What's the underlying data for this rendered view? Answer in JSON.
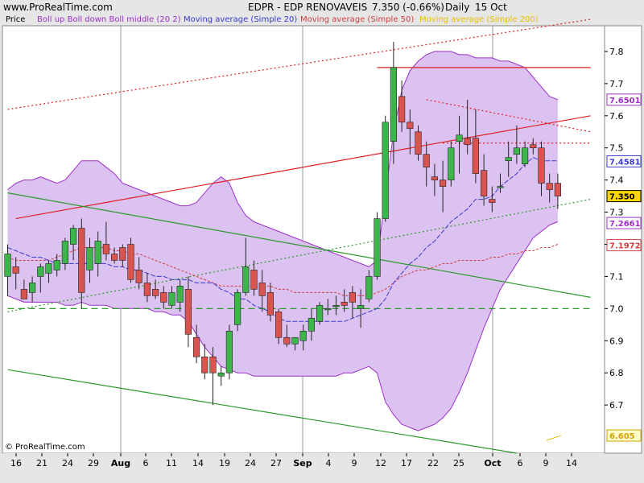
{
  "header": {
    "site": "www.ProRealTime.com",
    "title": "EDPR - EDP RENOVAVEIS",
    "quote": "7.350 (-0.66%)",
    "period": "Daily",
    "date": "15 Oct"
  },
  "legend": {
    "price": "Price",
    "bollinger": "Boll up Boll down Boll middle (20 2)",
    "ma20": "Moving average (Simple 20)",
    "ma50": "Moving average (Simple 50)",
    "ma200": "Moving average (Simple 200)"
  },
  "footer": {
    "copyright": "© ProRealTime.com"
  },
  "colors": {
    "up": "#3cb54a",
    "down": "#d9534f",
    "band_fill": "#dcc2f0",
    "band_line": "#9b30c8",
    "ma20": "#3a3acc",
    "ma50": "#d04040",
    "ma200": "#e8c000",
    "resistance": "#e02020",
    "trend_green": "#2a9a2a"
  },
  "chart_data": {
    "type": "candlestick",
    "ylim": [
      6.55,
      7.88
    ],
    "y_ticks": [
      6.7,
      6.8,
      6.9,
      7.0,
      7.1,
      7.2,
      7.3,
      7.4,
      7.5,
      7.6,
      7.7,
      7.8
    ],
    "x_labels": [
      "16",
      "21",
      "24",
      "29",
      "Aug",
      "6",
      "11",
      "14",
      "19",
      "24",
      "27",
      "Sep",
      "4",
      "9",
      "12",
      "17",
      "22",
      "25",
      "Oct",
      "6",
      "9",
      "14"
    ],
    "price_badges": [
      {
        "value": 7.6501,
        "text": "7.6501",
        "color": "#9b30c8"
      },
      {
        "value": 7.4581,
        "text": "7.4581",
        "color": "#3a3acc"
      },
      {
        "value": 7.35,
        "text": "7.350",
        "color": "#000000",
        "bg": "#ffd700"
      },
      {
        "value": 7.2661,
        "text": "7.2661",
        "color": "#9b30c8"
      },
      {
        "value": 7.1972,
        "text": "7.1972",
        "color": "#d04040"
      },
      {
        "value": 6.605,
        "text": "6.605",
        "color": "#d4a000",
        "bg": "#ffffcc"
      }
    ],
    "candles": [
      {
        "o": 7.1,
        "h": 7.2,
        "l": 7.04,
        "c": 7.17
      },
      {
        "o": 7.13,
        "h": 7.16,
        "l": 7.06,
        "c": 7.11
      },
      {
        "o": 7.06,
        "h": 7.09,
        "l": 7.03,
        "c": 7.03
      },
      {
        "o": 7.05,
        "h": 7.1,
        "l": 7.02,
        "c": 7.08
      },
      {
        "o": 7.1,
        "h": 7.14,
        "l": 7.05,
        "c": 7.13
      },
      {
        "o": 7.11,
        "h": 7.15,
        "l": 7.08,
        "c": 7.14
      },
      {
        "o": 7.12,
        "h": 7.17,
        "l": 7.1,
        "c": 7.15
      },
      {
        "o": 7.14,
        "h": 7.22,
        "l": 7.12,
        "c": 7.21
      },
      {
        "o": 7.2,
        "h": 7.26,
        "l": 7.15,
        "c": 7.25
      },
      {
        "o": 7.25,
        "h": 7.28,
        "l": 7.0,
        "c": 7.05
      },
      {
        "o": 7.12,
        "h": 7.22,
        "l": 7.08,
        "c": 7.19
      },
      {
        "o": 7.14,
        "h": 7.24,
        "l": 7.1,
        "c": 7.21
      },
      {
        "o": 7.2,
        "h": 7.27,
        "l": 7.15,
        "c": 7.17
      },
      {
        "o": 7.17,
        "h": 7.19,
        "l": 7.14,
        "c": 7.15
      },
      {
        "o": 7.19,
        "h": 7.2,
        "l": 7.13,
        "c": 7.15
      },
      {
        "o": 7.2,
        "h": 7.22,
        "l": 7.08,
        "c": 7.09
      },
      {
        "o": 7.12,
        "h": 7.16,
        "l": 7.06,
        "c": 7.08
      },
      {
        "o": 7.08,
        "h": 7.11,
        "l": 7.02,
        "c": 7.04
      },
      {
        "o": 7.06,
        "h": 7.09,
        "l": 7.03,
        "c": 7.04
      },
      {
        "o": 7.05,
        "h": 7.07,
        "l": 7.0,
        "c": 7.02
      },
      {
        "o": 7.01,
        "h": 7.07,
        "l": 7.0,
        "c": 7.05
      },
      {
        "o": 7.02,
        "h": 7.09,
        "l": 6.99,
        "c": 7.07
      },
      {
        "o": 7.06,
        "h": 7.1,
        "l": 6.88,
        "c": 6.92
      },
      {
        "o": 6.91,
        "h": 6.95,
        "l": 6.83,
        "c": 6.85
      },
      {
        "o": 6.85,
        "h": 6.89,
        "l": 6.78,
        "c": 6.8
      },
      {
        "o": 6.85,
        "h": 6.88,
        "l": 6.7,
        "c": 6.8
      },
      {
        "o": 6.79,
        "h": 6.82,
        "l": 6.76,
        "c": 6.8
      },
      {
        "o": 6.8,
        "h": 6.95,
        "l": 6.78,
        "c": 6.93
      },
      {
        "o": 6.95,
        "h": 7.06,
        "l": 6.93,
        "c": 7.05
      },
      {
        "o": 7.05,
        "h": 7.22,
        "l": 7.04,
        "c": 7.13
      },
      {
        "o": 7.12,
        "h": 7.15,
        "l": 7.04,
        "c": 7.06
      },
      {
        "o": 7.08,
        "h": 7.12,
        "l": 6.99,
        "c": 7.04
      },
      {
        "o": 7.05,
        "h": 7.08,
        "l": 6.96,
        "c": 6.98
      },
      {
        "o": 6.99,
        "h": 7.0,
        "l": 6.89,
        "c": 6.91
      },
      {
        "o": 6.91,
        "h": 6.95,
        "l": 6.88,
        "c": 6.89
      },
      {
        "o": 6.89,
        "h": 6.91,
        "l": 6.87,
        "c": 6.91
      },
      {
        "o": 6.9,
        "h": 6.95,
        "l": 6.87,
        "c": 6.93
      },
      {
        "o": 6.93,
        "h": 7.0,
        "l": 6.9,
        "c": 6.97
      },
      {
        "o": 6.96,
        "h": 7.02,
        "l": 6.95,
        "c": 7.01
      },
      {
        "o": 7.0,
        "h": 7.03,
        "l": 6.98,
        "c": 7.0
      },
      {
        "o": 7.01,
        "h": 7.04,
        "l": 6.98,
        "c": 7.01
      },
      {
        "o": 7.02,
        "h": 7.06,
        "l": 6.99,
        "c": 7.01
      },
      {
        "o": 7.05,
        "h": 7.07,
        "l": 6.97,
        "c": 7.02
      },
      {
        "o": 7.0,
        "h": 7.06,
        "l": 6.94,
        "c": 7.01
      },
      {
        "o": 7.03,
        "h": 7.12,
        "l": 7.02,
        "c": 7.1
      },
      {
        "o": 7.1,
        "h": 7.3,
        "l": 7.09,
        "c": 7.28
      },
      {
        "o": 7.28,
        "h": 7.6,
        "l": 7.27,
        "c": 7.58
      },
      {
        "o": 7.52,
        "h": 7.83,
        "l": 7.45,
        "c": 7.75
      },
      {
        "o": 7.66,
        "h": 7.71,
        "l": 7.55,
        "c": 7.58
      },
      {
        "o": 7.58,
        "h": 7.62,
        "l": 7.48,
        "c": 7.56
      },
      {
        "o": 7.55,
        "h": 7.57,
        "l": 7.46,
        "c": 7.48
      },
      {
        "o": 7.48,
        "h": 7.52,
        "l": 7.38,
        "c": 7.44
      },
      {
        "o": 7.41,
        "h": 7.45,
        "l": 7.35,
        "c": 7.4
      },
      {
        "o": 7.4,
        "h": 7.46,
        "l": 7.3,
        "c": 7.38
      },
      {
        "o": 7.4,
        "h": 7.52,
        "l": 7.38,
        "c": 7.5
      },
      {
        "o": 7.52,
        "h": 7.6,
        "l": 7.42,
        "c": 7.54
      },
      {
        "o": 7.53,
        "h": 7.65,
        "l": 7.48,
        "c": 7.51
      },
      {
        "o": 7.53,
        "h": 7.62,
        "l": 7.39,
        "c": 7.42
      },
      {
        "o": 7.43,
        "h": 7.48,
        "l": 7.32,
        "c": 7.35
      },
      {
        "o": 7.34,
        "h": 7.38,
        "l": 7.3,
        "c": 7.33
      },
      {
        "o": 7.38,
        "h": 7.42,
        "l": 7.36,
        "c": 7.38
      },
      {
        "o": 7.46,
        "h": 7.52,
        "l": 7.41,
        "c": 7.47
      },
      {
        "o": 7.48,
        "h": 7.57,
        "l": 7.45,
        "c": 7.5
      },
      {
        "o": 7.45,
        "h": 7.52,
        "l": 7.44,
        "c": 7.5
      },
      {
        "o": 7.51,
        "h": 7.53,
        "l": 7.48,
        "c": 7.5
      },
      {
        "o": 7.5,
        "h": 7.52,
        "l": 7.35,
        "c": 7.39
      },
      {
        "o": 7.39,
        "h": 7.42,
        "l": 7.33,
        "c": 7.37
      },
      {
        "o": 7.39,
        "h": 7.42,
        "l": 7.31,
        "c": 7.35
      }
    ],
    "boll_upper": [
      7.37,
      7.39,
      7.4,
      7.4,
      7.41,
      7.4,
      7.39,
      7.4,
      7.43,
      7.46,
      7.46,
      7.46,
      7.44,
      7.42,
      7.39,
      7.38,
      7.37,
      7.36,
      7.35,
      7.34,
      7.33,
      7.32,
      7.32,
      7.33,
      7.36,
      7.39,
      7.41,
      7.39,
      7.33,
      7.29,
      7.27,
      7.26,
      7.25,
      7.24,
      7.23,
      7.22,
      7.21,
      7.2,
      7.19,
      7.18,
      7.17,
      7.16,
      7.15,
      7.14,
      7.13,
      7.15,
      7.35,
      7.55,
      7.68,
      7.74,
      7.77,
      7.79,
      7.8,
      7.8,
      7.8,
      7.79,
      7.79,
      7.78,
      7.78,
      7.78,
      7.77,
      7.77,
      7.76,
      7.75,
      7.72,
      7.69,
      7.66,
      7.65
    ],
    "boll_lower": [
      7.04,
      7.03,
      7.02,
      7.02,
      7.02,
      7.02,
      7.02,
      7.01,
      7.01,
      7.02,
      7.01,
      7.01,
      7.01,
      7.0,
      7.0,
      7.0,
      7.0,
      7.0,
      6.99,
      6.99,
      6.98,
      6.98,
      6.96,
      6.92,
      6.88,
      6.85,
      6.82,
      6.81,
      6.8,
      6.8,
      6.79,
      6.79,
      6.79,
      6.79,
      6.79,
      6.79,
      6.79,
      6.79,
      6.79,
      6.79,
      6.79,
      6.8,
      6.8,
      6.81,
      6.82,
      6.8,
      6.71,
      6.67,
      6.64,
      6.63,
      6.62,
      6.63,
      6.64,
      6.66,
      6.69,
      6.74,
      6.8,
      6.87,
      6.94,
      7.0,
      7.06,
      7.1,
      7.14,
      7.18,
      7.22,
      7.24,
      7.26,
      7.27
    ],
    "ma20": [
      7.19,
      7.18,
      7.17,
      7.16,
      7.16,
      7.15,
      7.14,
      7.14,
      7.14,
      7.14,
      7.14,
      7.14,
      7.14,
      7.13,
      7.13,
      7.12,
      7.12,
      7.11,
      7.1,
      7.1,
      7.09,
      7.09,
      7.09,
      7.08,
      7.08,
      7.08,
      7.06,
      7.05,
      7.03,
      7.03,
      7.01,
      7.0,
      6.99,
      6.97,
      6.96,
      6.96,
      6.96,
      6.96,
      6.96,
      6.96,
      6.96,
      6.96,
      6.97,
      6.98,
      6.99,
      7.0,
      7.03,
      7.08,
      7.11,
      7.14,
      7.16,
      7.19,
      7.21,
      7.24,
      7.27,
      7.29,
      7.31,
      7.34,
      7.34,
      7.35,
      7.38,
      7.4,
      7.42,
      7.45,
      7.47,
      7.46,
      7.46,
      7.46
    ],
    "ma50": [
      7.16,
      7.15,
      7.15,
      7.15,
      7.15,
      7.15,
      7.16,
      7.17,
      7.18,
      7.19,
      7.19,
      7.19,
      7.19,
      7.18,
      7.18,
      7.17,
      7.17,
      7.16,
      7.15,
      7.14,
      7.13,
      7.12,
      7.11,
      7.1,
      7.09,
      7.08,
      7.07,
      7.07,
      7.07,
      7.07,
      7.07,
      7.07,
      7.07,
      7.06,
      7.06,
      7.05,
      7.05,
      7.05,
      7.05,
      7.05,
      7.05,
      7.04,
      7.04,
      7.04,
      7.04,
      7.05,
      7.06,
      7.08,
      7.1,
      7.11,
      7.12,
      7.12,
      7.13,
      7.14,
      7.14,
      7.15,
      7.15,
      7.15,
      7.15,
      7.16,
      7.16,
      7.17,
      7.17,
      7.18,
      7.18,
      7.19,
      7.19,
      7.2
    ],
    "ma200": [
      6.605,
      6.605,
      6.605,
      6.605,
      6.605,
      6.605,
      6.605,
      6.605,
      6.605,
      6.605,
      6.605,
      6.605,
      6.605,
      6.605,
      6.605,
      6.605,
      6.605,
      6.605,
      6.605,
      6.605,
      6.605,
      6.605,
      6.605,
      6.605,
      6.605,
      6.605,
      6.605,
      6.605,
      6.605,
      6.605,
      6.605,
      6.605,
      6.605,
      6.605,
      6.605,
      6.605,
      6.605,
      6.605,
      6.605,
      6.605,
      6.605,
      6.605,
      6.605,
      6.605,
      6.605,
      6.605,
      6.605,
      6.605,
      6.605,
      6.605,
      6.605,
      6.605,
      6.605,
      6.605,
      6.605,
      6.605,
      6.605,
      6.605,
      6.605,
      6.605,
      6.605,
      6.605,
      6.605,
      6.59,
      6.595,
      6.6,
      6.603,
      6.605
    ],
    "trendlines": [
      {
        "name": "resistance-line",
        "style": "solid",
        "color": "#e02020",
        "from": [
          45,
          7.75
        ],
        "to": [
          71,
          7.75
        ]
      },
      {
        "name": "upper-channel-solid",
        "style": "solid",
        "color": "#e02020",
        "from": [
          1,
          7.28
        ],
        "to": [
          71,
          7.6
        ]
      },
      {
        "name": "upper-channel-dotted",
        "style": "dotted",
        "color": "#e02020",
        "from": [
          0,
          7.62
        ],
        "to": [
          71,
          7.9
        ]
      },
      {
        "name": "falling-dotted-red",
        "style": "dotted",
        "color": "#e02020",
        "from": [
          51,
          7.65
        ],
        "to": [
          71,
          7.55
        ]
      },
      {
        "name": "horizontal-dotted-red",
        "style": "dotted",
        "color": "#e02020",
        "from": [
          53,
          7.515
        ],
        "to": [
          71,
          7.515
        ]
      },
      {
        "name": "falling-green",
        "style": "solid",
        "color": "#2a9a2a",
        "from": [
          0,
          7.36
        ],
        "to": [
          71,
          7.035
        ]
      },
      {
        "name": "lower-falling-green",
        "style": "solid",
        "color": "#2a9a2a",
        "from": [
          0,
          6.81
        ],
        "to": [
          62,
          6.55
        ]
      },
      {
        "name": "rising-dotted-green",
        "style": "dotted",
        "color": "#2a9a2a",
        "from": [
          0,
          6.99
        ],
        "to": [
          71,
          7.34
        ]
      },
      {
        "name": "support-dashed-green",
        "style": "dashed",
        "color": "#2a9a2a",
        "from": [
          0,
          7.0
        ],
        "to": [
          71,
          7.0
        ]
      }
    ]
  }
}
